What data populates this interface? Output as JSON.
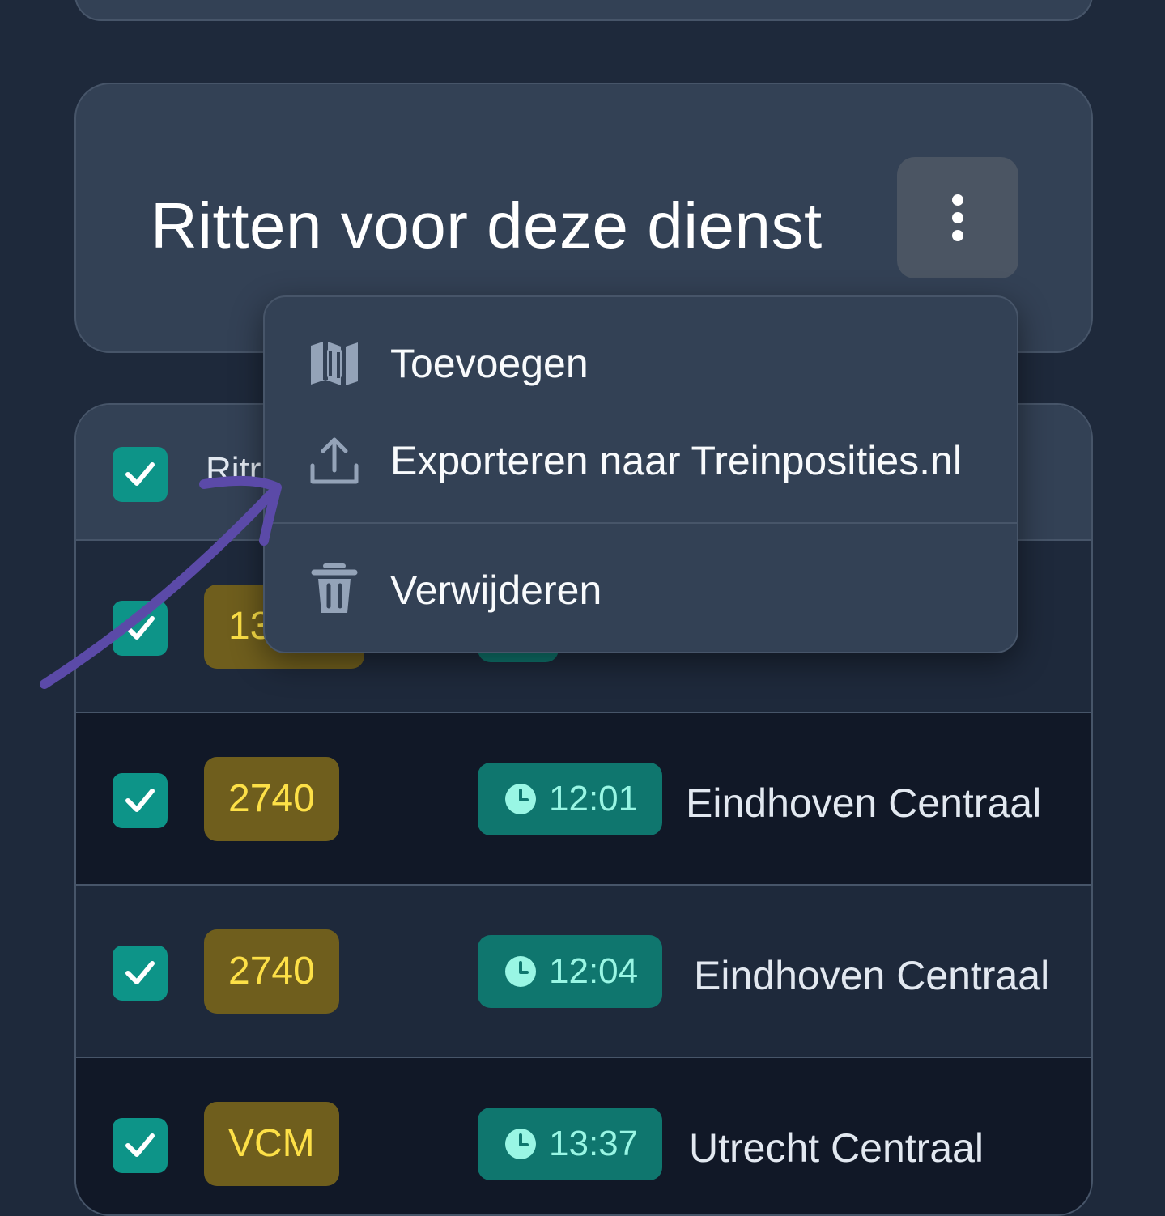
{
  "header": {
    "title": "Ritten voor deze dienst"
  },
  "menu": {
    "items": [
      {
        "label": "Toevoegen",
        "icon": "map-icon"
      },
      {
        "label": "Exporteren naar Treinposities.nl",
        "icon": "upload-icon"
      },
      {
        "label": "Verwijderen",
        "icon": "trash-icon"
      }
    ]
  },
  "table": {
    "header_label": "Ritr",
    "rows": [
      {
        "train": "13",
        "time": "",
        "station": ""
      },
      {
        "train": "2740",
        "time": "12:01",
        "station": "Eindhoven Centraal"
      },
      {
        "train": "2740",
        "time": "12:04",
        "station": "Eindhoven Centraal"
      },
      {
        "train": "VCM",
        "time": "13:37",
        "station": "Utrecht Centraal"
      }
    ]
  },
  "colors": {
    "background": "#1e293b",
    "card": "#334155",
    "checkbox": "#0d9488",
    "train_badge": "#6f5e1d",
    "train_text": "#fde047",
    "time_badge": "#0f766e",
    "time_text": "#99f6e4",
    "annotation_arrow": "#5b4aa8"
  }
}
